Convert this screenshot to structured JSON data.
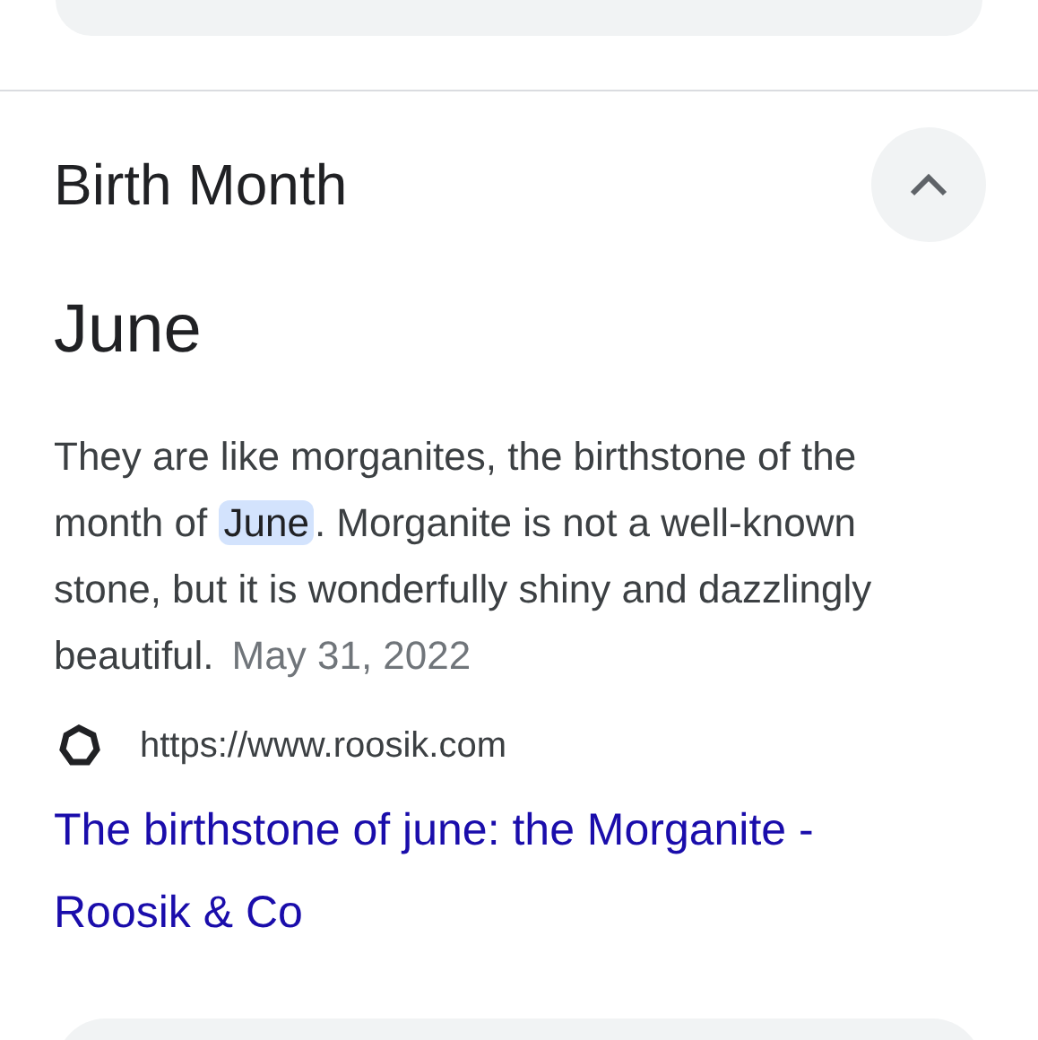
{
  "section": {
    "title": "Birth Month",
    "expanded": true
  },
  "answer": "June",
  "snippet": {
    "before": "They are like morganites, the birthstone of the month of ",
    "highlight": "June",
    "after": ". Morganite is not a well-known stone, but it is wonderfully shiny and dazzlingly beautiful.",
    "date": "May 31, 2022"
  },
  "source": {
    "url": "https://www.roosik.com",
    "title": "The birthstone of june: the Morganite - Roosik & Co"
  }
}
